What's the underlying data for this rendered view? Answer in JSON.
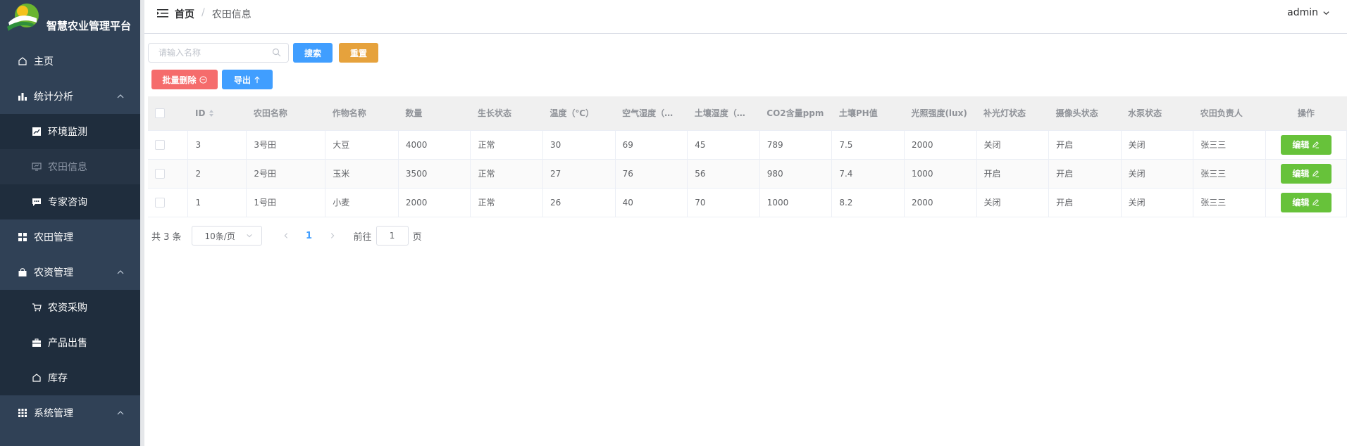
{
  "app": {
    "title": "智慧农业管理平台",
    "colors": {
      "sidebar": "#304156",
      "primary": "#409eff",
      "warning": "#e6a23c",
      "danger": "#f56c6c",
      "success": "#67c23a"
    }
  },
  "sidebar": {
    "items": [
      {
        "label": "主页",
        "icon": "home-icon"
      },
      {
        "label": "统计分析",
        "icon": "bar-chart-icon",
        "expanded": true
      },
      {
        "label": "环境监测",
        "icon": "line-chart-icon"
      },
      {
        "label": "农田信息",
        "icon": "monitor-icon",
        "active": true
      },
      {
        "label": "专家咨询",
        "icon": "chat-icon"
      },
      {
        "label": "农田管理",
        "icon": "grid-icon"
      },
      {
        "label": "农资管理",
        "icon": "bag-icon",
        "expanded": true
      },
      {
        "label": "农资采购",
        "icon": "cart-icon"
      },
      {
        "label": "产品出售",
        "icon": "briefcase-icon"
      },
      {
        "label": "库存",
        "icon": "home-icon"
      },
      {
        "label": "系统管理",
        "icon": "menu-grid-icon",
        "expanded": true
      }
    ]
  },
  "header": {
    "breadcrumb": {
      "home": "首页",
      "separator": "/",
      "current": "农田信息"
    },
    "user": "admin"
  },
  "toolbar": {
    "search_placeholder": "请输入名称",
    "search_label": "搜索",
    "reset_label": "重置",
    "batch_delete_label": "批量删除",
    "export_label": "导出"
  },
  "table": {
    "columns": [
      "ID",
      "农田名称",
      "作物名称",
      "数量",
      "生长状态",
      "温度（℃）",
      "空气湿度（…",
      "土壤湿度（…",
      "CO2含量ppm",
      "土壤PH值",
      "光照强度(lux)",
      "补光灯状态",
      "摄像头状态",
      "水泵状态",
      "农田负责人",
      "操作"
    ],
    "rows": [
      [
        "3",
        "3号田",
        "大豆",
        "4000",
        "正常",
        "30",
        "69",
        "45",
        "789",
        "7.5",
        "2000",
        "关闭",
        "开启",
        "关闭",
        "张三三"
      ],
      [
        "2",
        "2号田",
        "玉米",
        "3500",
        "正常",
        "27",
        "76",
        "56",
        "980",
        "7.4",
        "1000",
        "开启",
        "开启",
        "关闭",
        "张三三"
      ],
      [
        "1",
        "1号田",
        "小麦",
        "2000",
        "正常",
        "26",
        "40",
        "70",
        "1000",
        "8.2",
        "2000",
        "关闭",
        "开启",
        "关闭",
        "张三三"
      ]
    ],
    "edit_label": "编辑"
  },
  "pagination": {
    "total_text": "共 3 条",
    "page_size": "10条/页",
    "current_page": "1",
    "goto_prefix": "前往",
    "goto_value": "1",
    "goto_suffix": "页"
  }
}
